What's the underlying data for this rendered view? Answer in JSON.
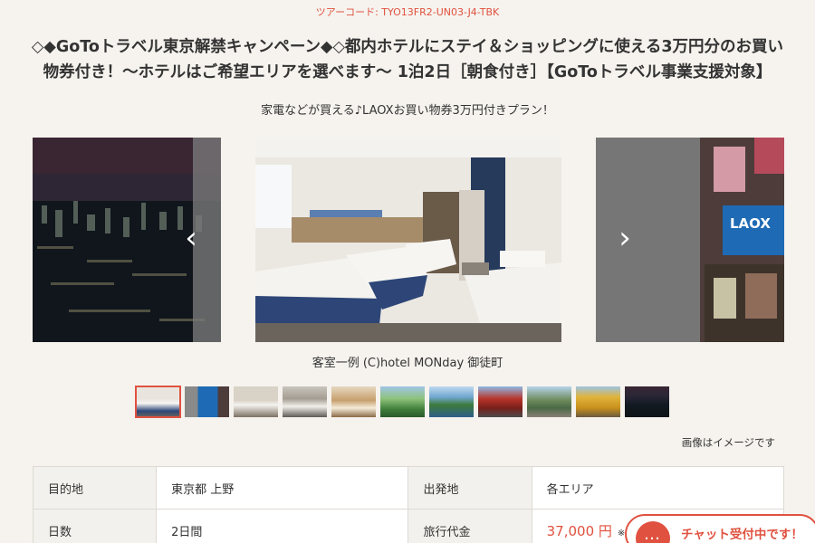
{
  "tour_code": "ツアーコード: TYO13FR2-UN03-J4-TBK",
  "title": "◇◆GoToトラベル東京解禁キャンペーン◆◇都内ホテルにステイ＆ショッピングに使える3万円分のお買い物券付き！～ホテルはご希望エリアを選べます～ 1泊2日［朝食付き］【GoToトラベル事業支援対象】",
  "subtitle": "家電などが買える♪LAOXお買い物券3万円付きプラン！",
  "carousel": {
    "caption": "客室一例 (C)hotel MONday 御徒町",
    "prev_icon": "‹",
    "next_icon": "›",
    "thumb_count": 11,
    "active_thumb": 1
  },
  "image_note": "画像はイメージです",
  "info": {
    "destination_label": "目的地",
    "destination_value": "東京都 上野",
    "departure_label": "出発地",
    "departure_value": "各エリア",
    "days_label": "日数",
    "days_value": "2日間",
    "price_label": "旅行代金",
    "price_value": "37,000 円",
    "price_note": "※"
  },
  "chat": {
    "label": "チャット受付中です！"
  },
  "colors": {
    "accent": "#e0513f",
    "background": "#f6f3ee"
  }
}
